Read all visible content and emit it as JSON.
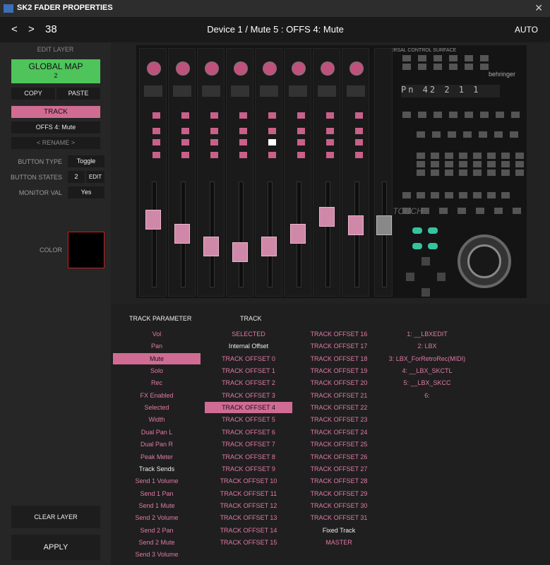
{
  "window": {
    "title": "SK2 FADER PROPERTIES",
    "close": "✕"
  },
  "header": {
    "prev": "<",
    "next": ">",
    "number": "38",
    "control_title": "Device 1 / Mute 5  :  OFFS 4: Mute",
    "auto_label": "AUTO"
  },
  "left": {
    "edit_layer": "EDIT LAYER",
    "global_map_label": "GLOBAL MAP",
    "global_map_value": "2",
    "copy": "COPY",
    "paste": "PASTE",
    "track": "TRACK",
    "offset_name": "OFFS 4: Mute",
    "rename": "< RENAME >",
    "button_type_label": "BUTTON TYPE",
    "button_type_value": "Toggle",
    "button_states_label": "BUTTON STATES",
    "button_states_value": "2",
    "edit": "EDIT",
    "monitor_val_label": "MONITOR VAL",
    "monitor_val_value": "Yes",
    "color_label": "COLOR",
    "color_value": "#000000",
    "clear_layer": "CLEAR LAYER",
    "apply": "APPLY"
  },
  "surface": {
    "brand": "behringer",
    "title": "UNIVERSAL CONTROL SURFACE",
    "logo": "X TOUCH",
    "strip_count": 8
  },
  "lists": {
    "track_parameter_header": "TRACK PARAMETER",
    "track_header": "TRACK",
    "track_parameters": [
      {
        "label": "Vol",
        "style": "pink"
      },
      {
        "label": "Pan",
        "style": "pink"
      },
      {
        "label": "Mute",
        "style": "sel"
      },
      {
        "label": "Solo",
        "style": "pink"
      },
      {
        "label": "Rec",
        "style": "pink"
      },
      {
        "label": "FX Enabled",
        "style": "pink"
      },
      {
        "label": "Selected",
        "style": "pink"
      },
      {
        "label": "Width",
        "style": "pink"
      },
      {
        "label": "Dual Pan L",
        "style": "pink"
      },
      {
        "label": "Dual Pan R",
        "style": "pink"
      },
      {
        "label": "Peak Meter",
        "style": "pink"
      },
      {
        "label": "Track Sends",
        "style": "white"
      },
      {
        "label": "Send 1 Volume",
        "style": "pink"
      },
      {
        "label": "Send 1 Pan",
        "style": "pink"
      },
      {
        "label": "Send 1 Mute",
        "style": "pink"
      },
      {
        "label": "Send 2 Volume",
        "style": "pink"
      },
      {
        "label": "Send 2 Pan",
        "style": "pink"
      },
      {
        "label": "Send 2 Mute",
        "style": "pink"
      },
      {
        "label": "Send 3 Volume",
        "style": "pink"
      }
    ],
    "track_col1": [
      {
        "label": "SELECTED",
        "style": "pink"
      },
      {
        "label": "Internal Offset",
        "style": "white"
      },
      {
        "label": "TRACK OFFSET 0",
        "style": "pink"
      },
      {
        "label": "TRACK OFFSET 1",
        "style": "pink"
      },
      {
        "label": "TRACK OFFSET 2",
        "style": "pink"
      },
      {
        "label": "TRACK OFFSET 3",
        "style": "pink"
      },
      {
        "label": "TRACK OFFSET 4",
        "style": "sel"
      },
      {
        "label": "TRACK OFFSET 5",
        "style": "pink"
      },
      {
        "label": "TRACK OFFSET 6",
        "style": "pink"
      },
      {
        "label": "TRACK OFFSET 7",
        "style": "pink"
      },
      {
        "label": "TRACK OFFSET 8",
        "style": "pink"
      },
      {
        "label": "TRACK OFFSET 9",
        "style": "pink"
      },
      {
        "label": "TRACK OFFSET 10",
        "style": "pink"
      },
      {
        "label": "TRACK OFFSET 11",
        "style": "pink"
      },
      {
        "label": "TRACK OFFSET 12",
        "style": "pink"
      },
      {
        "label": "TRACK OFFSET 13",
        "style": "pink"
      },
      {
        "label": "TRACK OFFSET 14",
        "style": "pink"
      },
      {
        "label": "TRACK OFFSET 15",
        "style": "pink"
      }
    ],
    "track_col2": [
      {
        "label": "TRACK OFFSET 16",
        "style": "pink"
      },
      {
        "label": "TRACK OFFSET 17",
        "style": "pink"
      },
      {
        "label": "TRACK OFFSET 18",
        "style": "pink"
      },
      {
        "label": "TRACK OFFSET 19",
        "style": "pink"
      },
      {
        "label": "TRACK OFFSET 20",
        "style": "pink"
      },
      {
        "label": "TRACK OFFSET 21",
        "style": "pink"
      },
      {
        "label": "TRACK OFFSET 22",
        "style": "pink"
      },
      {
        "label": "TRACK OFFSET 23",
        "style": "pink"
      },
      {
        "label": "TRACK OFFSET 24",
        "style": "pink"
      },
      {
        "label": "TRACK OFFSET 25",
        "style": "pink"
      },
      {
        "label": "TRACK OFFSET 26",
        "style": "pink"
      },
      {
        "label": "TRACK OFFSET 27",
        "style": "pink"
      },
      {
        "label": "TRACK OFFSET 28",
        "style": "pink"
      },
      {
        "label": "TRACK OFFSET 29",
        "style": "pink"
      },
      {
        "label": "TRACK OFFSET 30",
        "style": "pink"
      },
      {
        "label": "TRACK OFFSET 31",
        "style": "pink"
      },
      {
        "label": "Fixed Track",
        "style": "white"
      },
      {
        "label": "MASTER",
        "style": "pink"
      }
    ],
    "devices": [
      "1: __LBXEDIT",
      "2: LBX",
      "3: LBX_ForRetroRec(MIDI)",
      "4: __LBX_SKCTL",
      "5: __LBX_SKCC",
      "6:"
    ]
  },
  "colors": {
    "accent_pink": "#d06c94",
    "global_green": "#4ec45a",
    "teal": "#35c3a0"
  }
}
